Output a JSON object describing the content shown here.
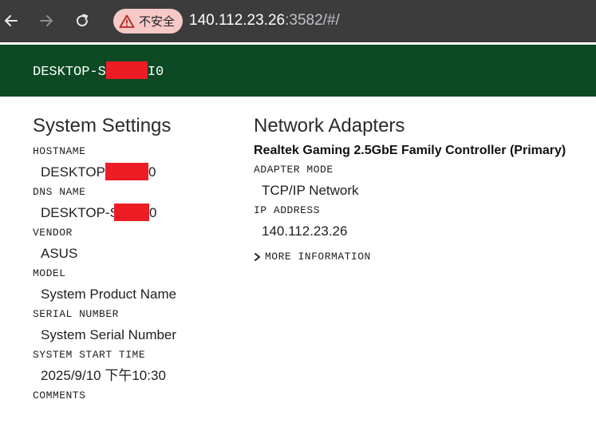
{
  "browser": {
    "security_label": "不安全",
    "url_host": "140.112.23.26",
    "url_rest": ":3582/#/",
    "icons": [
      "back-arrow-icon",
      "forward-arrow-icon",
      "reload-icon",
      "warning-triangle-icon"
    ]
  },
  "header": {
    "title_prefix": "DESKTOP-S",
    "title_suffix": "I0",
    "background": "#0b4a23"
  },
  "system_settings": {
    "heading": "System Settings",
    "hostname_label": "HOSTNAME",
    "hostname_prefix": "DESKTOP",
    "hostname_suffix": "0",
    "dns_label": "DNS NAME",
    "dns_prefix": "DESKTOP-S",
    "dns_suffix": "0",
    "vendor_label": "VENDOR",
    "vendor_value": "ASUS",
    "model_label": "MODEL",
    "model_value": "System Product Name",
    "serial_label": "SERIAL NUMBER",
    "serial_value": "System Serial Number",
    "start_label": "SYSTEM START TIME",
    "start_value": "2025/9/10 下午10:30",
    "comments_label": "COMMENTS"
  },
  "network_adapters": {
    "heading": "Network Adapters",
    "adapter_name": "Realtek Gaming 2.5GbE Family Controller (Primary)",
    "mode_label": "ADAPTER MODE",
    "mode_value": "TCP/IP Network",
    "ip_label": "IP ADDRESS",
    "ip_value": "140.112.23.26",
    "more_label": "MORE INFORMATION"
  }
}
